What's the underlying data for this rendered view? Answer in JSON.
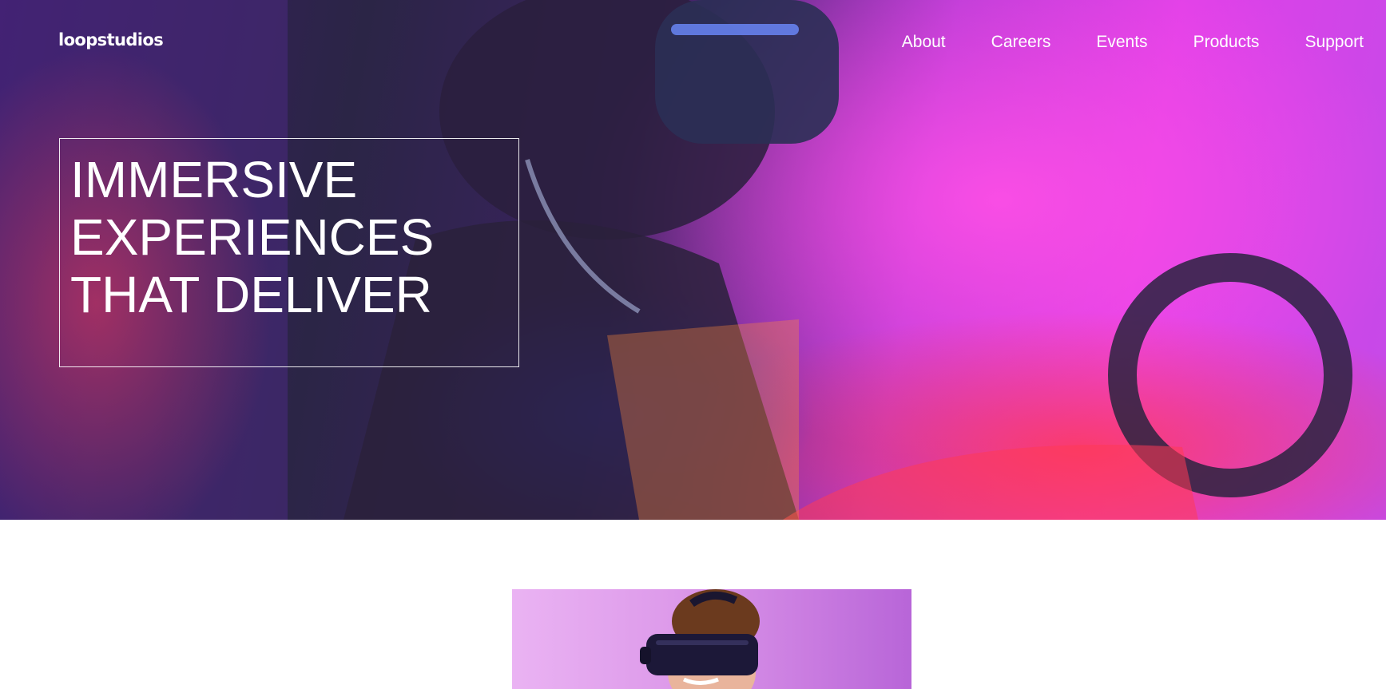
{
  "header": {
    "logo": "loopstudios",
    "nav": [
      {
        "label": "About"
      },
      {
        "label": "Careers"
      },
      {
        "label": "Events"
      },
      {
        "label": "Products"
      },
      {
        "label": "Support"
      }
    ]
  },
  "hero": {
    "headline": [
      "IMMERSIVE",
      "EXPERIENCES",
      "THAT DELIVER"
    ],
    "image_icon": "vr-player-photo-icon"
  },
  "section": {
    "image_icon": "vr-headset-person-photo-icon"
  },
  "colors": {
    "text": "#ffffff",
    "hero_magenta": "#e040e8",
    "hero_dark": "#2b2546",
    "section_bg": "#ffffff"
  }
}
